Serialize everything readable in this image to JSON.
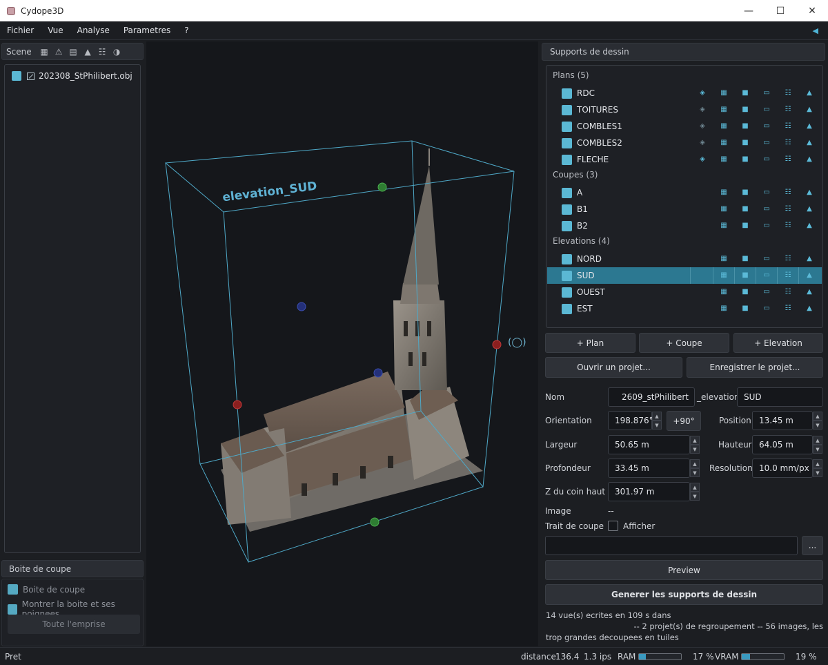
{
  "window": {
    "title": "Cydope3D"
  },
  "menu": {
    "items": [
      "Fichier",
      "Vue",
      "Analyse",
      "Parametres",
      "?"
    ]
  },
  "scene": {
    "header": "Scene",
    "tools": [
      "checker-icon",
      "warning-icon",
      "chart-icon",
      "elevation-icon",
      "columns-icon",
      "shade-icon"
    ],
    "items": [
      {
        "label": "202308_StPhilibert.obj",
        "checked": true
      }
    ]
  },
  "viewport": {
    "overlay_label": "elevation_SUD"
  },
  "boite": {
    "header": "Boite de coupe",
    "option1": "Boite de coupe",
    "option2": "Montrer la boite et ses poignees",
    "button": "Toute l'emprise"
  },
  "supports": {
    "header": "Supports de dessin",
    "groups": [
      {
        "label": "Plans (5)",
        "items": [
          "RDC",
          "TOITURES",
          "COMBLES1",
          "COMBLES2",
          "FLECHE"
        ]
      },
      {
        "label": "Coupes (3)",
        "items": [
          "A",
          "B1",
          "B2"
        ]
      },
      {
        "label": "Elevations (4)",
        "items": [
          "NORD",
          "SUD",
          "OUEST",
          "EST"
        ]
      }
    ],
    "selected": "SUD"
  },
  "buttons": {
    "add_plan": "+ Plan",
    "add_coupe": "+ Coupe",
    "add_elevation": "+ Elevation",
    "open_project": "Ouvrir un projet...",
    "save_project": "Enregistrer le projet...",
    "browse": "...",
    "preview": "Preview",
    "generate": "Generer les supports de dessin",
    "plus90": "+90°"
  },
  "form": {
    "nom_label": "Nom",
    "nom_prefix": "2609_stPhilibert",
    "nom_middle": "_elevation_",
    "nom_suffix": "SUD",
    "orientation_label": "Orientation",
    "orientation": "198.876°",
    "position_label": "Position",
    "position": "13.45 m",
    "largeur_label": "Largeur",
    "largeur": "50.65 m",
    "hauteur_label": "Hauteur",
    "hauteur": "64.05 m",
    "profondeur_label": "Profondeur",
    "profondeur": "33.45 m",
    "resolution_label": "Resolution",
    "resolution": "10.0 mm/px",
    "zcoin_label": "Z du coin haut",
    "zcoin": "301.97 m",
    "image_label": "Image",
    "image_value": "--",
    "trait_label": "Trait de coupe",
    "afficher": "Afficher",
    "path_value": ""
  },
  "log": {
    "line1": "14 vue(s) ecrites en 109 s dans",
    "line2": "-- 2 projet(s) de regroupement -- 56 images, les",
    "line3": "trop grandes decoupees en tuiles"
  },
  "status": {
    "state": "Pret",
    "distance_label": "distance",
    "distance": "136.4",
    "fps": "1.3 ips",
    "ram_label": "RAM",
    "ram_pct": "17 %",
    "ram_fraction": 0.17,
    "vram_label": "VRAM",
    "vram_pct": "19 %",
    "vram_fraction": 0.19,
    "accent": "#5bb8d4"
  }
}
